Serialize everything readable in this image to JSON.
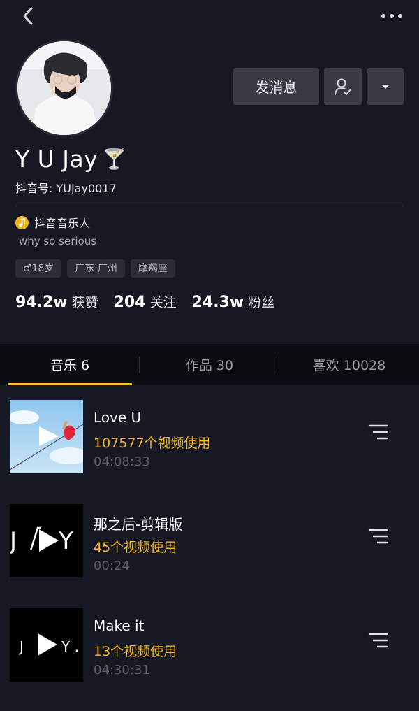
{
  "profile": {
    "name": "Y U Jay",
    "name_emoji": "🍸",
    "douyin_id": "抖音号: YUJay0017",
    "badge": "抖音音乐人",
    "bio": "why so serious",
    "tags": [
      "♂18岁",
      "广东·广州",
      "摩羯座"
    ],
    "stats": [
      {
        "value": "94.2w",
        "label": "获赞"
      },
      {
        "value": "204",
        "label": "关注"
      },
      {
        "value": "24.3w",
        "label": "粉丝"
      }
    ]
  },
  "actions": {
    "message_label": "发消息"
  },
  "tabs": [
    {
      "label": "音乐 6",
      "active": true
    },
    {
      "label": "作品 30",
      "active": false
    },
    {
      "label": "喜欢 10028",
      "active": false
    }
  ],
  "tracks": [
    {
      "title": "Love U",
      "uses": "107577个视频使用",
      "duration": "04:08:33"
    },
    {
      "title": "那之后-剪辑版",
      "uses": "45个视频使用",
      "duration": "00:24"
    },
    {
      "title": "Make it",
      "uses": "13个视频使用",
      "duration": "04:30:31"
    }
  ],
  "colors": {
    "accent": "#f3b51b",
    "background": "#161823",
    "button": "#3a3a44"
  }
}
